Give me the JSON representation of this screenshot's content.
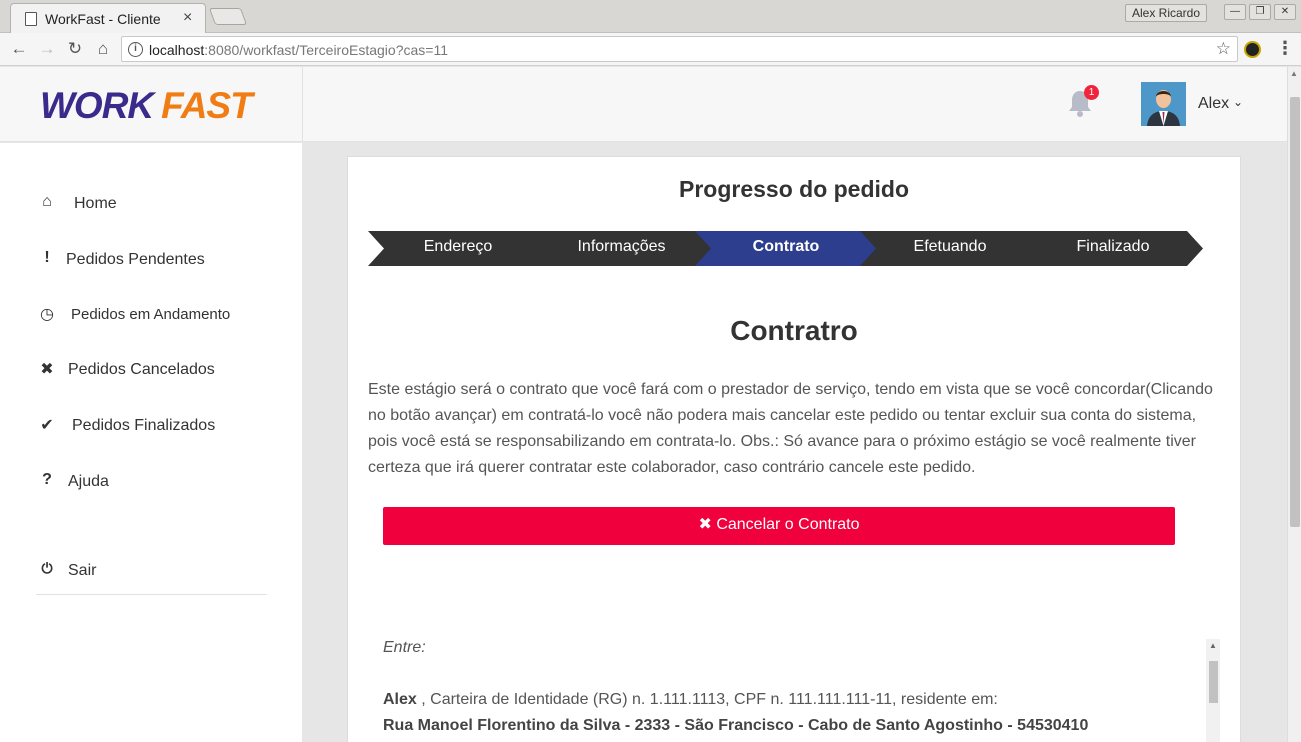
{
  "browser": {
    "tab_title": "WorkFast - Cliente",
    "tab_close": "×",
    "window_user": "Alex Ricardo",
    "win_buttons": [
      "—",
      "❐",
      "✕"
    ],
    "url_host": "localhost",
    "url_path": ":8080/workfast/TerceiroEstagio?cas=11"
  },
  "header": {
    "logo_part1": "WORK",
    "logo_part2": "FAST",
    "notification_count": "1",
    "user_name": "Alex",
    "user_chevron": "⌄"
  },
  "sidebar": {
    "items": [
      {
        "icon": "⌂",
        "icon_name": "home-icon",
        "label": "Home"
      },
      {
        "icon": "!",
        "icon_name": "exclamation-icon",
        "label": "Pedidos Pendentes"
      },
      {
        "icon": "◷",
        "icon_name": "clock-icon",
        "label": "Pedidos em Andamento"
      },
      {
        "icon": "✖",
        "icon_name": "times-icon",
        "label": "Pedidos Cancelados"
      },
      {
        "icon": "✔",
        "icon_name": "check-icon",
        "label": "Pedidos Finalizados"
      },
      {
        "icon": "?",
        "icon_name": "question-icon",
        "label": "Ajuda"
      }
    ],
    "logout": {
      "icon": "⏻",
      "icon_name": "power-icon",
      "label": "Sair"
    }
  },
  "main": {
    "title": "Progresso do pedido",
    "steps": [
      {
        "label": "Endereço",
        "active": false
      },
      {
        "label": "Informações",
        "active": false
      },
      {
        "label": "Contrato",
        "active": true
      },
      {
        "label": "Efetuando",
        "active": false
      },
      {
        "label": "Finalizado",
        "active": false
      }
    ],
    "section_title": "Contratro",
    "description": "Este estágio será o contrato que você fará com o prestador de serviço, tendo em vista que se você concordar(Clicando no botão avançar) em contratá-lo você não podera mais cancelar este pedido ou tentar excluir sua conta do sistema, pois você está se responsabilizando em contrata-lo. Obs.: Só avance para o próximo estágio se você realmente tiver certeza que irá querer contratar este colaborador, caso contrário cancele este pedido.",
    "cancel_button": "✖ Cancelar o Contrato",
    "contract": {
      "entre": "Entre:",
      "party_name": "Alex",
      "party_details": " , Carteira de Identidade (RG) n. 1.111.1113, CPF n. 111.111.111-11, residente em:",
      "address": "Rua Manoel Florentino da Silva - 2333 - São Francisco - Cabo de Santo Agostinho - 54530410"
    }
  },
  "colors": {
    "step_default": "#333333",
    "step_active": "#2d3e8f",
    "cancel_button": "#f0003c",
    "logo_primary": "#3a2a8c",
    "logo_accent": "#f07c13",
    "badge": "#f0243d"
  }
}
